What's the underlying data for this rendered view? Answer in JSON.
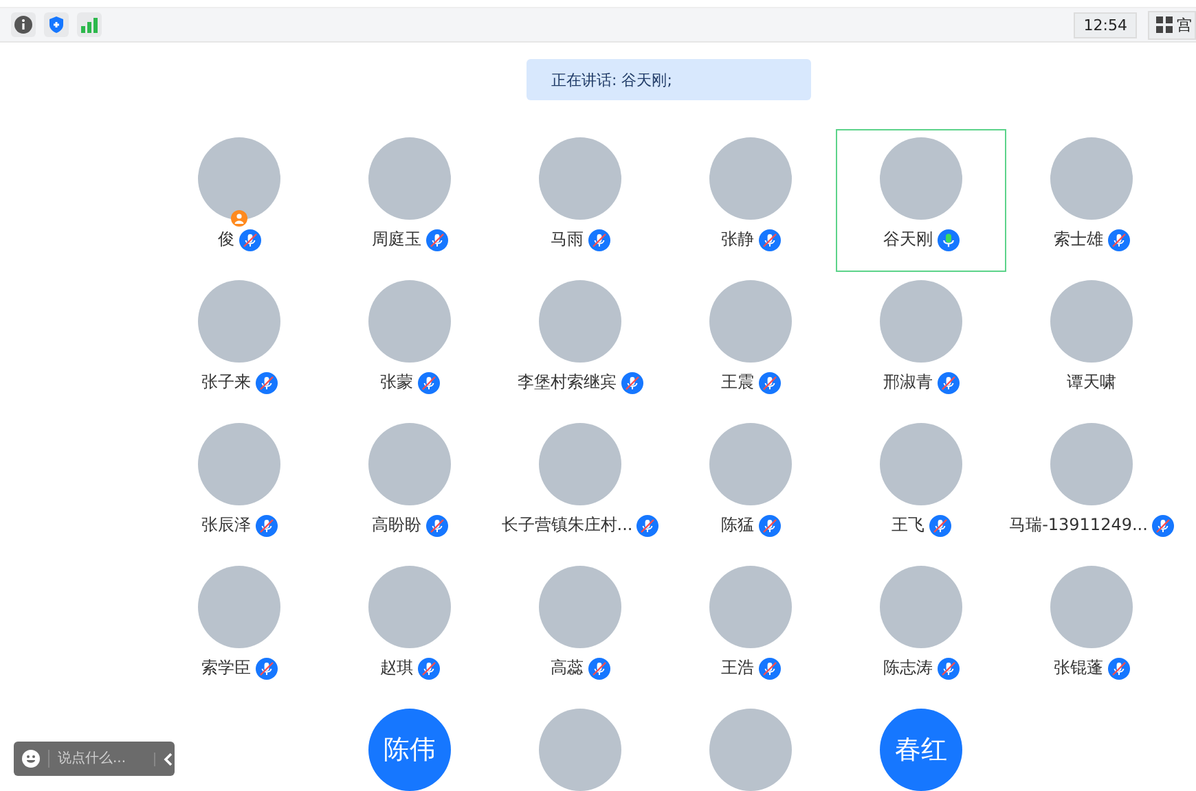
{
  "top_bar": {
    "time": "12:54",
    "view_button": "宫"
  },
  "speaking_banner": "正在讲话: 谷天刚;",
  "participants": [
    {
      "kind": "photo",
      "name": "俊",
      "muted": true,
      "speaking": false,
      "host": true,
      "highlighted": false
    },
    {
      "kind": "photo",
      "name": "周庭玉",
      "muted": true,
      "speaking": false,
      "host": false,
      "highlighted": false
    },
    {
      "kind": "photo",
      "name": "马雨",
      "muted": true,
      "speaking": false,
      "host": false,
      "highlighted": false
    },
    {
      "kind": "photo",
      "name": "张静",
      "muted": true,
      "speaking": false,
      "host": false,
      "highlighted": false
    },
    {
      "kind": "photo",
      "name": "谷天刚",
      "muted": false,
      "speaking": true,
      "host": false,
      "highlighted": true
    },
    {
      "kind": "photo",
      "name": "索士雄",
      "muted": true,
      "speaking": false,
      "host": false,
      "highlighted": false
    },
    {
      "kind": "photo",
      "name": "张子来",
      "muted": true,
      "speaking": false,
      "host": false,
      "highlighted": false
    },
    {
      "kind": "photo",
      "name": "张蒙",
      "muted": true,
      "speaking": false,
      "host": false,
      "highlighted": false
    },
    {
      "kind": "photo",
      "name": "李堡村索继宾",
      "muted": true,
      "speaking": false,
      "host": false,
      "highlighted": false
    },
    {
      "kind": "photo",
      "name": "王震",
      "muted": true,
      "speaking": false,
      "host": false,
      "highlighted": false
    },
    {
      "kind": "photo",
      "name": "邢淑青",
      "muted": true,
      "speaking": false,
      "host": false,
      "highlighted": false
    },
    {
      "kind": "photo",
      "name": "谭天啸",
      "muted": false,
      "speaking": false,
      "host": false,
      "highlighted": false
    },
    {
      "kind": "photo",
      "name": "张辰泽",
      "muted": true,
      "speaking": false,
      "host": false,
      "highlighted": false
    },
    {
      "kind": "photo",
      "name": "高盼盼",
      "muted": true,
      "speaking": false,
      "host": false,
      "highlighted": false
    },
    {
      "kind": "photo",
      "name": "长子营镇朱庄村...",
      "muted": true,
      "speaking": false,
      "host": false,
      "highlighted": false
    },
    {
      "kind": "photo",
      "name": "陈猛",
      "muted": true,
      "speaking": false,
      "host": false,
      "highlighted": false
    },
    {
      "kind": "photo",
      "name": "王飞",
      "muted": true,
      "speaking": false,
      "host": false,
      "highlighted": false
    },
    {
      "kind": "photo",
      "name": "马瑞-13911249...",
      "muted": true,
      "speaking": false,
      "host": false,
      "highlighted": false
    },
    {
      "kind": "photo",
      "name": "索学臣",
      "muted": true,
      "speaking": false,
      "host": false,
      "highlighted": false
    },
    {
      "kind": "photo",
      "name": "赵琪",
      "muted": true,
      "speaking": false,
      "host": false,
      "highlighted": false
    },
    {
      "kind": "photo",
      "name": "高蕊",
      "muted": true,
      "speaking": false,
      "host": false,
      "highlighted": false
    },
    {
      "kind": "photo",
      "name": "王浩",
      "muted": true,
      "speaking": false,
      "host": false,
      "highlighted": false
    },
    {
      "kind": "photo",
      "name": "陈志涛",
      "muted": true,
      "speaking": false,
      "host": false,
      "highlighted": false
    },
    {
      "kind": "photo",
      "name": "张锟蓬",
      "muted": true,
      "speaking": false,
      "host": false,
      "highlighted": false
    },
    {
      "kind": "text",
      "initials": "陈伟",
      "host": false,
      "highlighted": false
    },
    {
      "kind": "photo",
      "host": false,
      "highlighted": false
    },
    {
      "kind": "photo",
      "host": false,
      "highlighted": false
    },
    {
      "kind": "text",
      "initials": "春红",
      "host": false,
      "highlighted": false
    }
  ],
  "chat_bar": {
    "placeholder": "说点什么..."
  }
}
